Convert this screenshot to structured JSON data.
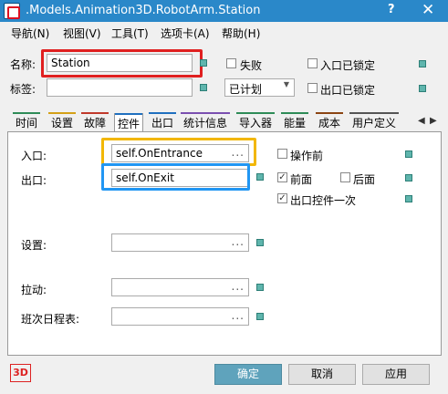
{
  "window": {
    "title": ".Models.Animation3D.RobotArm.Station",
    "help_glyph": "?",
    "close_glyph": "✕"
  },
  "menu": {
    "items": [
      "导航(N)",
      "视图(V)",
      "工具(T)",
      "选项卡(A)",
      "帮助(H)"
    ]
  },
  "header": {
    "name_label": "名称:",
    "name_value": "Station",
    "tag_label": "标签:",
    "tag_value": "",
    "failed_label": "失败",
    "failed_checked": false,
    "status_value": "已计划",
    "entrance_locked_label": "入口已锁定",
    "exit_locked_label": "出口已锁定"
  },
  "tabs": [
    {
      "label": "时间",
      "color": "#2e8b57"
    },
    {
      "label": "设置",
      "color": "#d4a017"
    },
    {
      "label": "故障",
      "color": "#c0392b"
    },
    {
      "label": "控件",
      "color": "#1f6fbf",
      "active": true
    },
    {
      "label": "出口",
      "color": "#1f6fbf"
    },
    {
      "label": "统计信息",
      "color": "#7a4fb0"
    },
    {
      "label": "导入器",
      "color": "#2e8b57"
    },
    {
      "label": "能量",
      "color": "#2e8b57"
    },
    {
      "label": "成本",
      "color": "#8b4513"
    },
    {
      "label": "用户定义",
      "color": "#555555"
    }
  ],
  "controls": {
    "entrance_label": "入口:",
    "entrance_value": "self.OnEntrance",
    "exit_label": "出口:",
    "exit_value": "self.OnExit",
    "before_action_label": "操作前",
    "before_action_checked": false,
    "front_label": "前面",
    "front_checked": true,
    "rear_label": "后面",
    "rear_checked": false,
    "exit_once_label": "出口控件一次",
    "exit_once_checked": true,
    "setup_label": "设置:",
    "setup_value": "",
    "pull_label": "拉动:",
    "pull_value": "",
    "shift_label": "班次日程表:",
    "shift_value": "",
    "ellipsis": "..."
  },
  "footer": {
    "logo_text": "3D",
    "ok_label": "确定",
    "cancel_label": "取消",
    "apply_label": "应用"
  },
  "colors": {
    "titlebar": "#2a88c9",
    "highlight_red": "#e02020",
    "highlight_orange": "#f2b705",
    "highlight_blue": "#2196f3",
    "teal_button": "#5fb5ad"
  }
}
